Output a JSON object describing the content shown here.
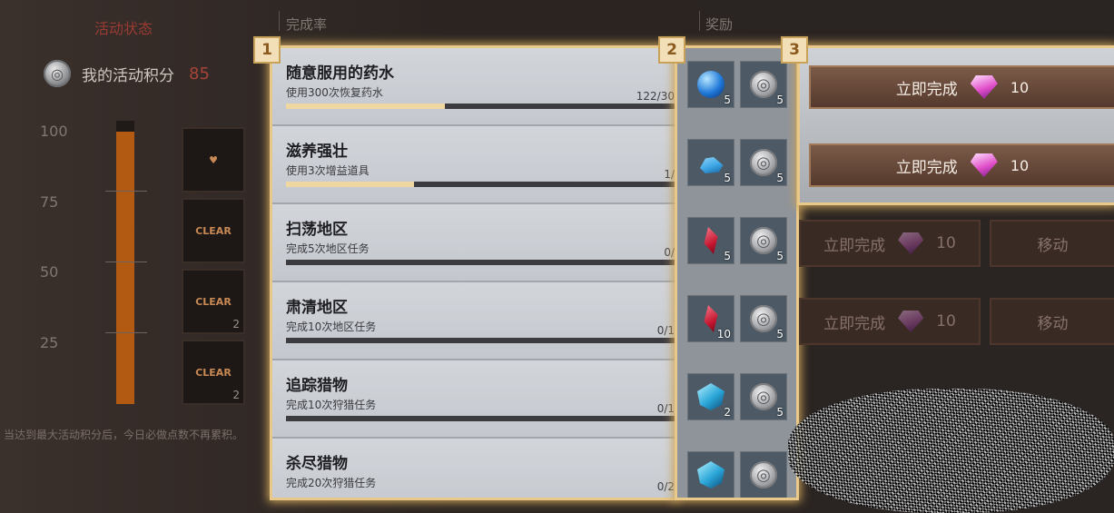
{
  "left": {
    "title": "活动状态",
    "score_label": "我的活动积分",
    "score_value": "85",
    "ticks": [
      "100",
      "75",
      "50",
      "25"
    ],
    "gauge_level_percent": 100,
    "reward_cards": [
      {
        "label": "",
        "count": ""
      },
      {
        "label": "CLEAR",
        "count": ""
      },
      {
        "label": "CLEAR",
        "count": "2"
      },
      {
        "label": "CLEAR",
        "count": "2"
      }
    ],
    "note": "当达到最大活动积分后，今日必做点数不再累积。"
  },
  "headers": {
    "completion": "完成率",
    "reward": "奖励"
  },
  "badges": [
    "1",
    "2",
    "3"
  ],
  "tasks": [
    {
      "title": "随意服用的药水",
      "desc": "使用300次恢复药水",
      "progress_text": "122/30",
      "progress": 0.41,
      "rewards": [
        {
          "icon": "blue-orb-icon",
          "count": "5"
        },
        {
          "icon": "silver-coin-icon",
          "count": "5"
        }
      ]
    },
    {
      "title": "滋养强壮",
      "desc": "使用3次增益道具",
      "progress_text": "1/",
      "progress": 0.33,
      "rewards": [
        {
          "icon": "blue-crystal-icon",
          "count": "5"
        },
        {
          "icon": "silver-coin-icon",
          "count": "5"
        }
      ]
    },
    {
      "title": "扫荡地区",
      "desc": "完成5次地区任务",
      "progress_text": "0/",
      "progress": 0,
      "rewards": [
        {
          "icon": "red-crystal-icon",
          "count": "5"
        },
        {
          "icon": "silver-coin-icon",
          "count": "5"
        }
      ]
    },
    {
      "title": "肃清地区",
      "desc": "完成10次地区任务",
      "progress_text": "0/1",
      "progress": 0,
      "rewards": [
        {
          "icon": "red-crystal-icon",
          "count": "10"
        },
        {
          "icon": "silver-coin-icon",
          "count": "5"
        }
      ]
    },
    {
      "title": "追踪猎物",
      "desc": "完成10次狩猎任务",
      "progress_text": "0/1",
      "progress": 0,
      "rewards": [
        {
          "icon": "blue-cube-icon",
          "count": "2"
        },
        {
          "icon": "silver-coin-icon",
          "count": "5"
        }
      ]
    },
    {
      "title": "杀尽猎物",
      "desc": "完成20次狩猎任务",
      "progress_text": "0/2",
      "progress": 0,
      "rewards": [
        {
          "icon": "blue-cube-icon",
          "count": ""
        },
        {
          "icon": "silver-coin-icon",
          "count": ""
        }
      ]
    }
  ],
  "actions": [
    {
      "label": "立即完成",
      "cost": "10"
    },
    {
      "label": "立即完成",
      "cost": "10"
    }
  ],
  "dim_actions": [
    {
      "label": "立即完成",
      "cost": "10",
      "move": "移动"
    },
    {
      "label": "立即完成",
      "cost": "10",
      "move": "移动"
    }
  ],
  "colors": {
    "highlight_border": "#e9c98a",
    "score": "#a8433a",
    "title": "#9a3b33",
    "progress_fill": "#eed7a0"
  }
}
